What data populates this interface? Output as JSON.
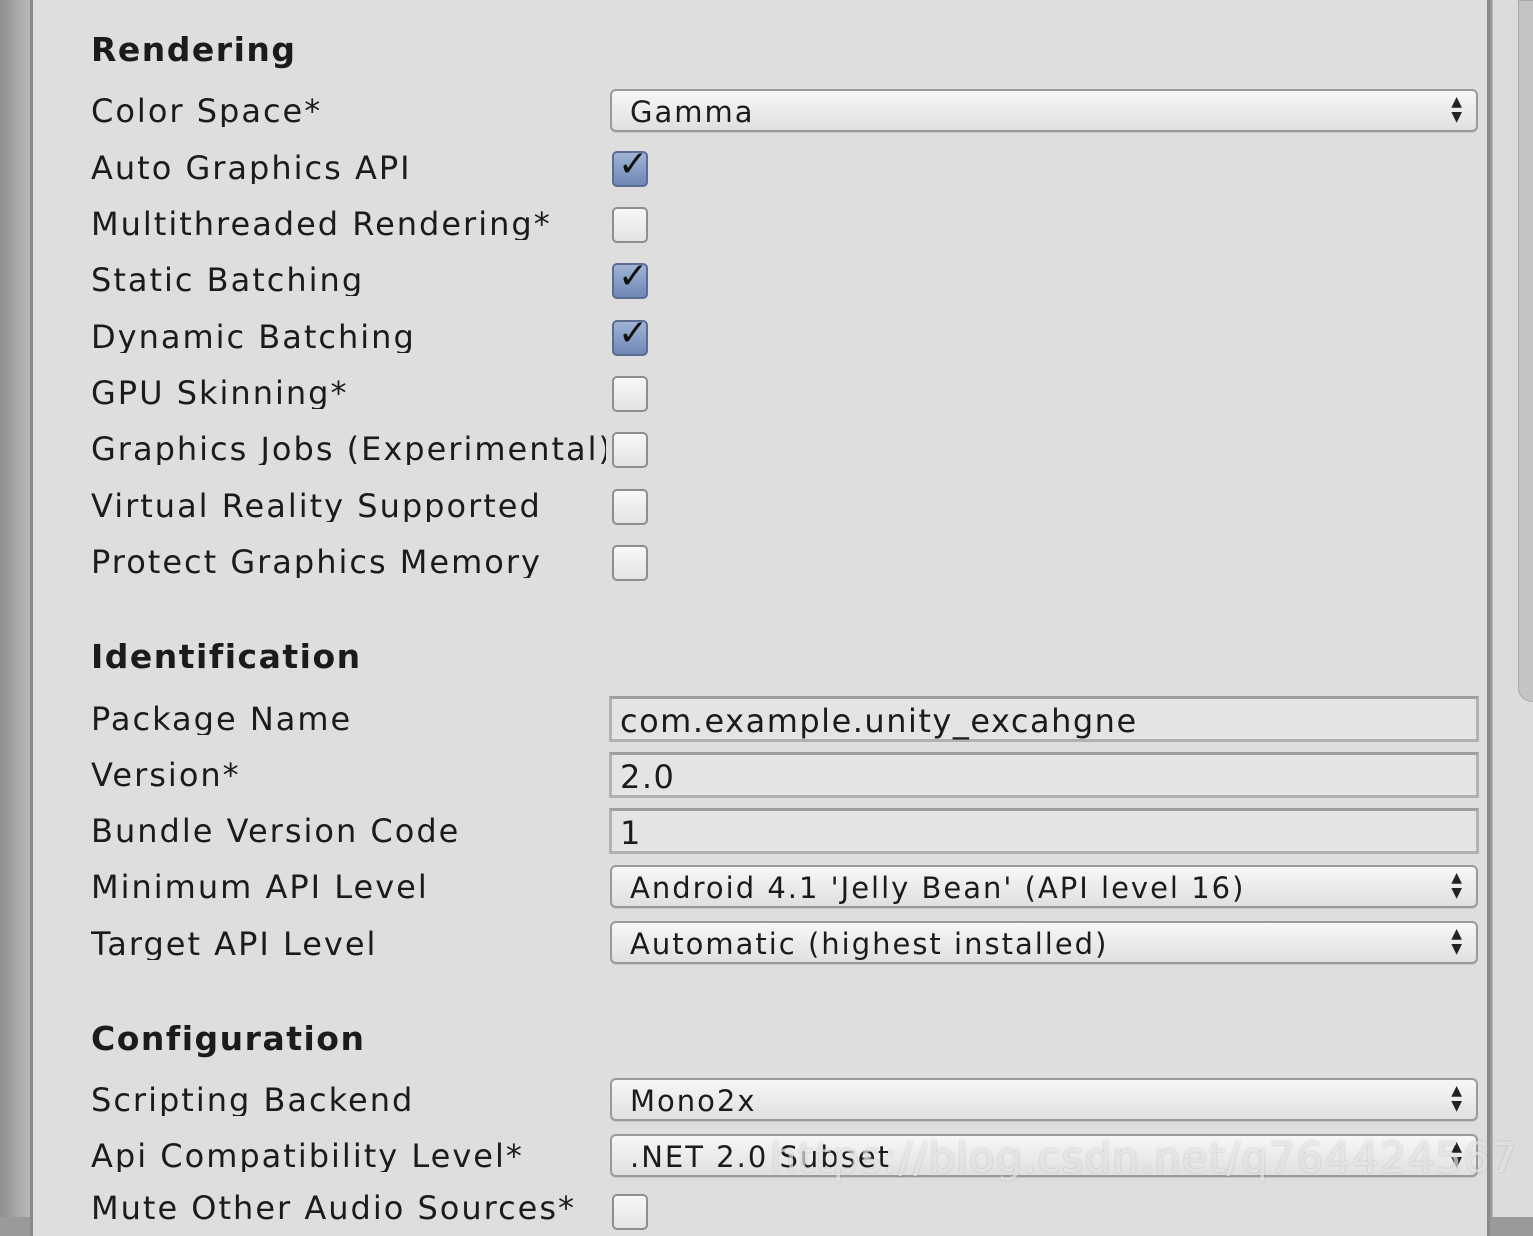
{
  "sections": {
    "rendering": "Rendering",
    "identification": "Identification",
    "configuration": "Configuration"
  },
  "rendering": {
    "color_space": {
      "label": "Color Space*",
      "value": "Gamma"
    },
    "auto_graphics_api": {
      "label": "Auto Graphics API",
      "checked": true
    },
    "multithreaded_rendering": {
      "label": "Multithreaded Rendering*",
      "checked": false
    },
    "static_batching": {
      "label": "Static Batching",
      "checked": true
    },
    "dynamic_batching": {
      "label": "Dynamic Batching",
      "checked": true
    },
    "gpu_skinning": {
      "label": "GPU Skinning*",
      "checked": false
    },
    "graphics_jobs": {
      "label": "Graphics Jobs (Experimental)",
      "checked": false
    },
    "virtual_reality": {
      "label": "Virtual Reality Supported",
      "checked": false
    },
    "protect_graphics_memory": {
      "label": "Protect Graphics Memory",
      "checked": false
    }
  },
  "identification": {
    "package_name": {
      "label": "Package Name",
      "value": "com.example.unity_excahgne"
    },
    "version": {
      "label": "Version*",
      "value": "2.0"
    },
    "bundle_version_code": {
      "label": "Bundle Version Code",
      "value": "1"
    },
    "minimum_api_level": {
      "label": "Minimum API Level",
      "value": "Android 4.1 'Jelly Bean' (API level 16)"
    },
    "target_api_level": {
      "label": "Target API Level",
      "value": "Automatic (highest installed)"
    }
  },
  "configuration": {
    "scripting_backend": {
      "label": "Scripting Backend",
      "value": "Mono2x"
    },
    "api_compatibility_level": {
      "label": "Api Compatibility Level*",
      "value": ".NET 2.0 Subset"
    },
    "mute_other_audio": {
      "label": "Mute Other Audio Sources*",
      "checked": false
    }
  },
  "watermark": "https://blog.csdn.net/q764424567",
  "icons": {
    "check": "checkmark-icon",
    "dropdown": "updown-arrows-icon"
  },
  "colors": {
    "panel_bg": "#dedede",
    "checkbox_on": "#7f97c2"
  }
}
